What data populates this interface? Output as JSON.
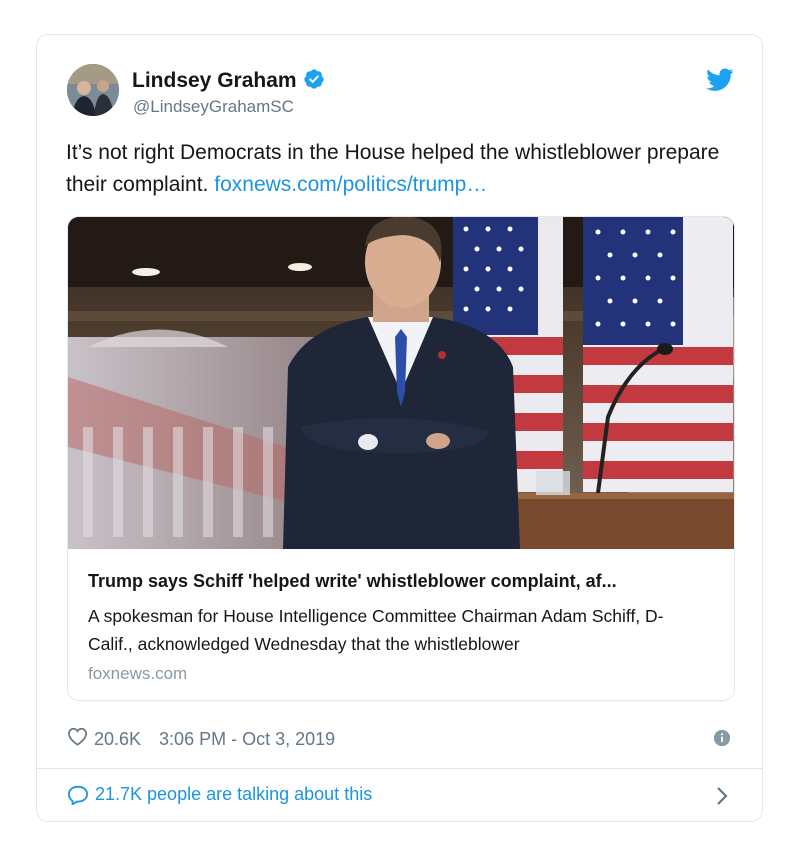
{
  "author": {
    "name": "Lindsey Graham",
    "handle": "@LindseyGrahamSC",
    "verified": true
  },
  "tweet": {
    "text": "It’s not right Democrats in the House helped the whistleblower prepare their complaint.",
    "link": "foxnews.com/politics/trump…"
  },
  "card": {
    "title": "Trump says Schiff 'helped write' whistleblower complaint, af...",
    "description": "A spokesman for House Intelligence Committee Chairman Adam Schiff, D-Calif., acknowledged Wednesday that the whistleblower",
    "domain": "foxnews.com"
  },
  "meta": {
    "likes": "20.6K",
    "timestamp": "3:06 PM - Oct 3, 2019"
  },
  "footer": {
    "talking": "21.7K people are talking about this"
  },
  "icons": {
    "verified": "verified-badge-icon",
    "brand": "twitter-bird-icon",
    "like": "heart-icon",
    "info": "info-icon",
    "reply": "comment-bubble-icon",
    "chevron": "chevron-right-icon"
  },
  "colors": {
    "accent": "#1b95e0",
    "muted": "#657786",
    "border": "#e1e8ed"
  }
}
